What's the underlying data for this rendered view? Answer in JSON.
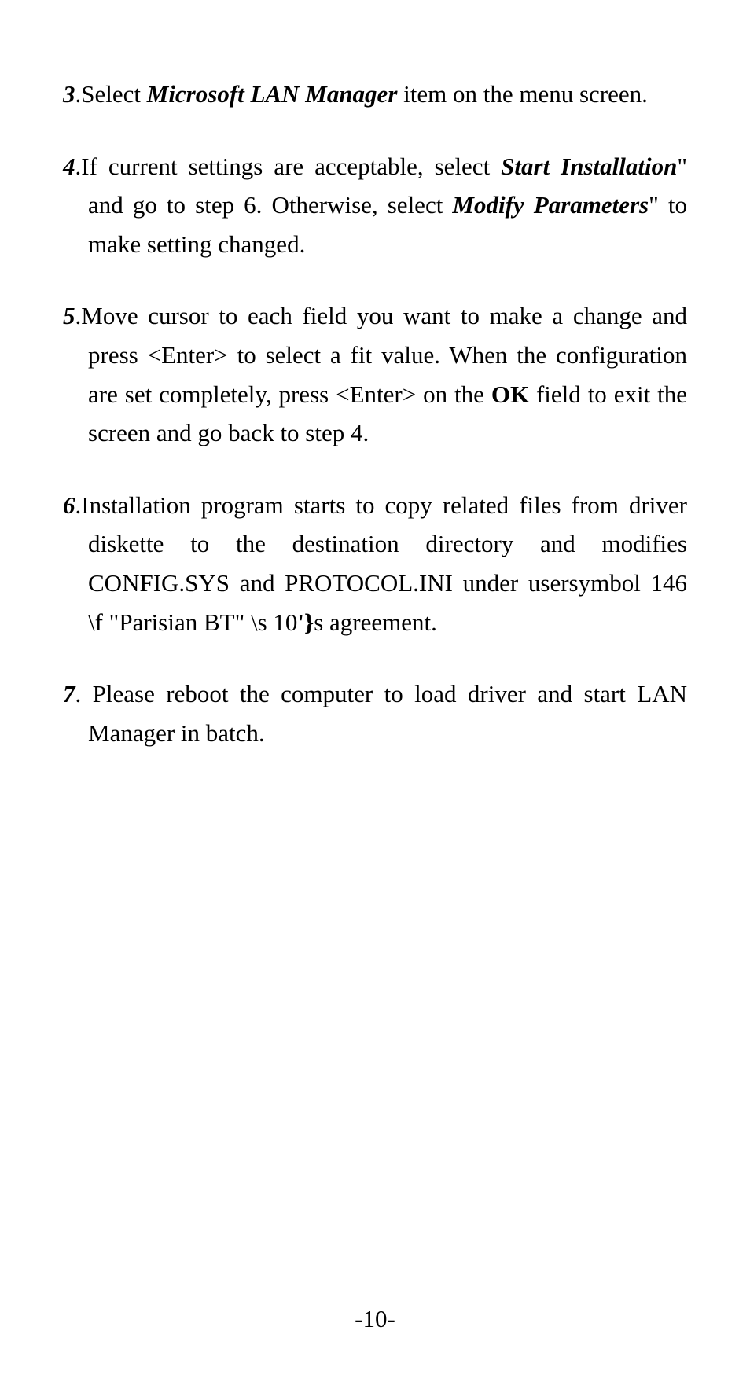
{
  "items": [
    {
      "number": "3",
      "text_before": ".Select ",
      "emphasis1": "Microsoft LAN Manager",
      "text_after": " item on the menu screen."
    },
    {
      "number": "4",
      "text_before": ".If current settings are acceptable, select ",
      "emphasis1": "Start Installation",
      "text_mid": "\" and go to step 6. Otherwise, select ",
      "emphasis2": "Modify Parameters",
      "text_after": "\" to make setting changed."
    },
    {
      "number": "5",
      "text_before": ".Move cursor to each field you want to make a change and press <Enter> to select a fit value. When the configuration are set completely, press <Enter> on the ",
      "emphasis1": "OK",
      "text_after": " field to exit the screen and go back to step 4."
    },
    {
      "number": "6",
      "text_before": ".Installation program starts to copy related files from driver diskette to the destination directory and modifies CONFIG.SYS and PROTOCOL.INI under usersymbol 146 \\f \"Parisian BT\" \\s 10",
      "emphasis1": "'}",
      "text_after": "s agreement."
    },
    {
      "number": "7",
      "text_before": ". Please reboot the computer to load driver and start LAN Manager in batch."
    }
  ],
  "page_number": "-10-"
}
